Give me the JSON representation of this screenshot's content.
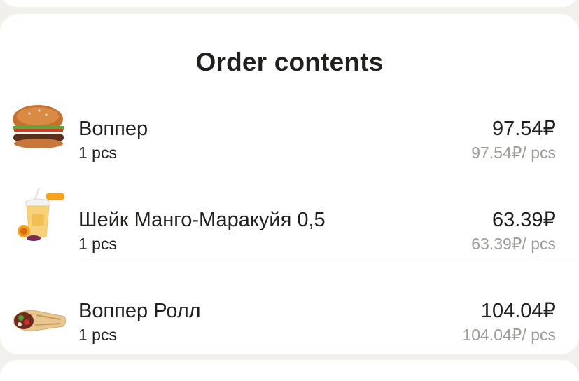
{
  "order": {
    "title": "Order contents",
    "items": [
      {
        "name": "Воппер",
        "quantity": "1 pcs",
        "price": "97.54₽",
        "unit_price": "97.54₽/ pcs",
        "icon": "burger-icon"
      },
      {
        "name": "Шейк Манго-Маракуйя 0,5",
        "quantity": "1 pcs",
        "price": "63.39₽",
        "unit_price": "63.39₽/ pcs",
        "icon": "milkshake-icon"
      },
      {
        "name": "Воппер Ролл",
        "quantity": "1 pcs",
        "price": "104.04₽",
        "unit_price": "104.04₽/ pcs",
        "icon": "wrap-roll-icon"
      }
    ]
  },
  "colors": {
    "background": "#f2f0ed",
    "card": "#ffffff",
    "text": "#21201f",
    "muted": "#9e9b98",
    "divider": "#e6e3df"
  }
}
